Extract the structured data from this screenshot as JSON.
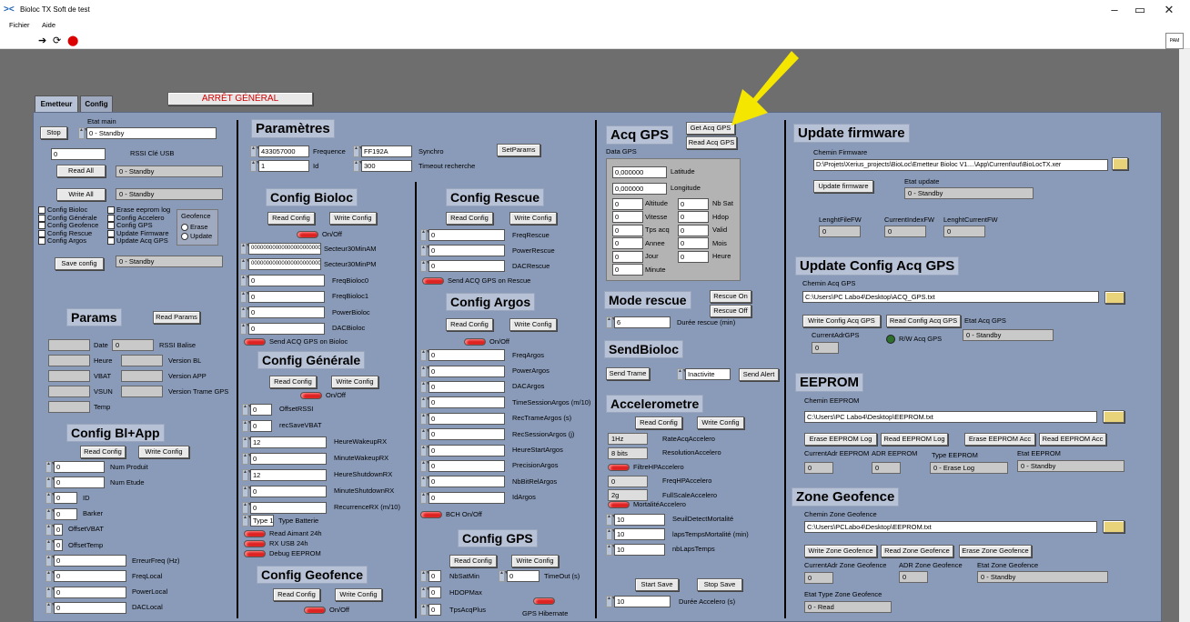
{
  "window": {
    "title": "Bioloc TX Soft de test",
    "minimize": "–",
    "restore": "▭",
    "close": "✕"
  },
  "menu": [
    "Fichier",
    "Aide"
  ],
  "toolbar": {
    "run": "➔",
    "run_cont": "⟳",
    "abort": "⬤"
  },
  "tabs": [
    "Emetteur",
    "Config"
  ],
  "arret": "ARRÊT GÉNÉRAL",
  "col1": {
    "etat_main": "Etat main",
    "stop": "Stop",
    "standby": "0 - Standby",
    "zero": "0",
    "rssi_usb": "RSSI Clé USB",
    "read_all": "Read All",
    "write_all": "Write All",
    "checks": [
      "Config Bioloc",
      "Config Générale",
      "Config Geofence",
      "Config Rescue",
      "Config Argos",
      "Erase eeprom log",
      "Config Accelero",
      "Config GPS",
      "Update Firmware",
      "Update Acq GPS"
    ],
    "geofence": "Geofence",
    "erase": "Erase",
    "update": "Update",
    "save_config": "Save config",
    "params": "Params",
    "read_params": "Read Params",
    "param_labels": [
      "Date",
      "Heure",
      "VBAT",
      "VSUN",
      "Temp"
    ],
    "param_labels2": [
      "RSSI Balise",
      "Version BL",
      "Version APP",
      "Version Trame GPS"
    ],
    "config_blapp": "Config Bl+App",
    "read_config": "Read Config",
    "write_config": "Write Config",
    "blapp_rows": [
      "Num Produit",
      "Num Etude",
      "ID",
      "Barker",
      "OffsetVBAT",
      "OffsetTemp",
      "ErreurFreq (Hz)",
      "FreqLocal",
      "PowerLocal",
      "DACLocal"
    ]
  },
  "col2": {
    "parametres": "Paramètres",
    "frequence_val": "433057000",
    "frequence": "Frequence",
    "synchro_val": "FF192A",
    "synchro": "Synchro",
    "setparams": "SetParams",
    "id_val": "1",
    "id": "Id",
    "timeout_val": "300",
    "timeout": "Timeout recherche",
    "config_bioloc": "Config Bioloc",
    "onoff": "On/Off",
    "sect_val": "000000000000000000000000",
    "sect_am": "Secteur30MinAM",
    "sect_pm": "Secteur30MinPM",
    "bioloc_rows": [
      "FreqBioloc0",
      "FreqBioloc1",
      "PowerBioloc",
      "DACBioloc"
    ],
    "send_acq_bioloc": "Send ACQ GPS on Bioloc",
    "config_generale": "Config Générale",
    "gen_rows": [
      "OffsetRSSI",
      "recSaveVBAT",
      "HeureWakeupRX",
      "MinuteWakeupRX",
      "HeureShutdownRX",
      "MinuteShutdownRX",
      "RecurrenceRX (m/10)"
    ],
    "gen_vals": [
      "0",
      "0",
      "12",
      "0",
      "12",
      "0",
      "0"
    ],
    "type_val": "Type 1",
    "type_batt": "Type Batterie",
    "read_aimant": "Read Aimant 24h",
    "rx_usb": "RX USB 24h",
    "debug": "Debug EEPROM",
    "config_geofence": "Config Geofence"
  },
  "col3": {
    "config_rescue": "Config Rescue",
    "rescue_rows": [
      "FreqRescue",
      "PowerRescue",
      "DACRescue"
    ],
    "send_acq_rescue": "Send ACQ GPS on Rescue",
    "config_argos": "Config Argos",
    "argos_rows": [
      "FreqArgos",
      "PowerArgos",
      "DACArgos",
      "TimeSessionArgos (m/10)",
      "RecTrameArgos (s)",
      "RecSessionArgos (j)",
      "HeureStartArgos",
      "PrecisionArgos",
      "NbBitRelArgos",
      "IdArgos"
    ],
    "bch": "BCH On/Off",
    "config_gps": "Config GPS",
    "nbsatmin": "NbSatMin",
    "timeout": "TimeOut (s)",
    "hdopmax": "HDOPMax",
    "tpsacqplus": "TpsAcqPlus",
    "gps_hib": "GPS Hibernate"
  },
  "col4": {
    "acq_gps": "Acq GPS",
    "get_acq": "Get Acq GPS",
    "read_acq": "Read Acq GPS",
    "data_gps": "Data GPS",
    "lat_val": "0,000000",
    "lat": "Latitude",
    "lon_val": "0,000000",
    "lon": "Longitude",
    "gps_left": [
      "Altitude",
      "Vitesse",
      "Tps acq",
      "Annee",
      "Jour",
      "Minute"
    ],
    "gps_right": [
      "Nb Sat",
      "Hdop",
      "Valid",
      "Mois",
      "Heure"
    ],
    "mode_rescue": "Mode rescue",
    "rescue_on": "Rescue On",
    "rescue_off": "Rescue Off",
    "duree_val": "6",
    "duree": "Durée rescue (min)",
    "sendbioloc": "SendBioloc",
    "send_trame": "Send Trame",
    "inactivite": "Inactivite",
    "send_alert": "Send Alert",
    "accelerometre": "Accelerometre",
    "acc_rows": [
      "RateAcqAccelero",
      "ResolutionAccelero",
      "FiltreHPAccelero",
      "FreqHPAccelero",
      "FullScaleAccelero"
    ],
    "acc_vals": [
      "1Hz",
      "8 bits",
      "",
      "0",
      "2g"
    ],
    "mortalite": "MortalitéAccelero",
    "mort_rows": [
      "SeuilDetectMortalité",
      "lapsTempsMortalité (min)",
      "nbLapsTemps"
    ],
    "mort_vals": [
      "10",
      "10",
      "10"
    ],
    "start_save": "Start Save",
    "stop_save": "Stop Save",
    "duree_acc": "Durée Accelero (s)",
    "duree_acc_val": "10"
  },
  "col5": {
    "update_fw": "Update firmware",
    "chemin_fw": "Chemin Firmware",
    "fw_path": "D:\\Projets\\Xerius_projects\\BioLoc\\Emetteur Bioloc V1....\\App\\Current\\out\\BioLocTX.xer",
    "update_btn": "Update firmware",
    "etat_update": "Etat update",
    "lfw": "LenghtFileFW",
    "cidx": "CurrentIndexFW",
    "lcur": "LenghtCurrentFW",
    "update_cfg": "Update Config Acq GPS",
    "chemin_acq": "Chemin Acq GPS",
    "acq_path": "C:\\Users\\PC Labo4\\Desktop\\ACQ_GPS.txt",
    "write_acq": "Write Config Acq GPS",
    "read_acq": "Read Config Acq GPS",
    "etat_acq": "Etat Acq GPS",
    "cur_acq": "CurrentAdrGPS",
    "rw": "R/W Acq GPS",
    "eeprom": "EEPROM",
    "chemin_ee": "Chemin EEPROM",
    "ee_path": "C:\\Users\\PC Labo4\\Desktop\\EEPROM.txt",
    "erase_log": "Erase EEPROM Log",
    "read_log": "Read EEPROM Log",
    "erase_acc": "Erase EEPROM Acc",
    "read_acc": "Read EEPROM Acc",
    "cur_ee": "CurrentAdr EEPROM",
    "adr_ee": "ADR EEPROM",
    "type_ee": "Type EEPROM",
    "etat_ee": "Etat EEPROM",
    "erase_log_v": "0 - Erase Log",
    "zone": "Zone Geofence",
    "chemin_zone": "Chemin Zone Geofence",
    "zone_path": "C:\\Users\\PCLabo4\\Desktop\\EEPROM.txt",
    "write_zone": "Write Zone Geofence",
    "read_zone": "Read Zone Geofence",
    "erase_zone": "Erase Zone Geofence",
    "cur_zone": "CurrentAdr Zone Geofence",
    "adr_zone": "ADR Zone Geofence",
    "etat_zone": "Etat Zone Geofence",
    "etat_type": "Etat Type Zone Geofence",
    "read_v": "0 - Read"
  },
  "colors": {
    "panel": "#8a9bb9",
    "led_red": "#d22",
    "arrow": "#f5e600"
  }
}
